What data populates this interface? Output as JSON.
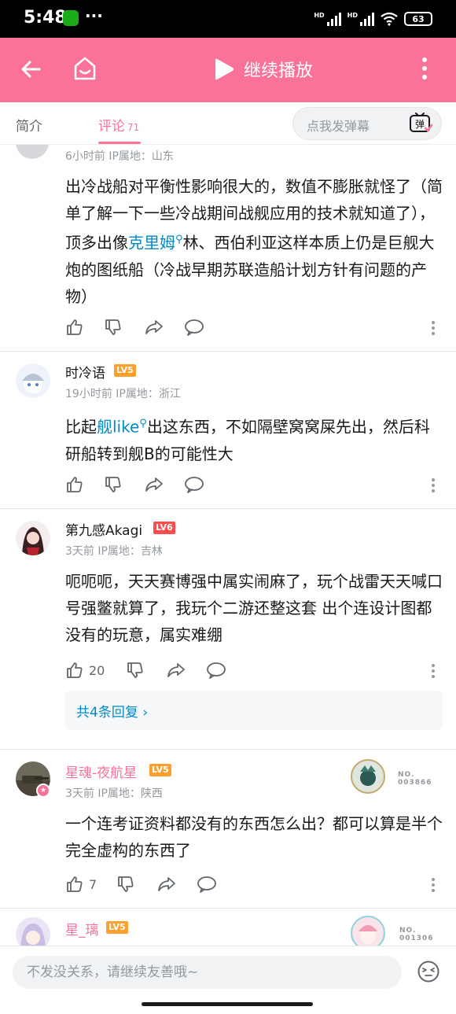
{
  "status": {
    "time": "5:48",
    "dots": "···",
    "hd1": "HD",
    "hd2": "HD",
    "battery": "63"
  },
  "header": {
    "title": "继续播放"
  },
  "tabs": {
    "intro": "简介",
    "comments": "评论",
    "comments_count": "71",
    "danmaku_placeholder": "点我发弹幕",
    "danmaku_icon_char": "弹"
  },
  "comments": [
    {
      "meta": "6小时前 IP属地：山东",
      "text_a": "出冷战船对平衡性影响很大的，数值不膨胀就怪了（简单了解一下一些冷战期间战舰应用的技术就知道了），顶多出像",
      "keyword": "克里姆",
      "text_b": "林、西伯利亚这样本质上仍是巨舰大炮的图纸船（冷战早期苏联造船计划方针有问题的产物）"
    },
    {
      "name": "时冷语",
      "level": "LV5",
      "meta": "19小时前 IP属地：浙江",
      "text_a": "比起",
      "keyword": "舰like",
      "text_b": "出这东西，不如隔壁窝窝屎先出，然后科研船转到舰B的可能性大"
    },
    {
      "name": "第九感Akagi",
      "level": "LV6",
      "meta": "3天前 IP属地：吉林",
      "text": "呃呃呃，天天赛博强中属实闹麻了，玩个战雷天天喊口号强鳖就算了，我玩个二游还整这套 出个连设计图都没有的玩意，属实难绷",
      "likes": "20",
      "replies": "共4条回复"
    },
    {
      "name": "星魂-夜航星",
      "level": "LV5",
      "meta": "3天前 IP属地：陕西",
      "text": "一个连考证资料都没有的东西怎么出？都可以算是半个完全虚构的东西了",
      "likes": "7",
      "badge_no_1": "NO.",
      "badge_no_2": "003866"
    },
    {
      "name": "星_璃",
      "level": "LV5",
      "badge_no_1": "NO.",
      "badge_no_2": "001306"
    }
  ],
  "bottom": {
    "input_placeholder": "不发没关系，请继续友善哦~"
  },
  "colors": {
    "accent": "#fb7299",
    "link": "#008ac5",
    "lv5": "#ff9f2e",
    "lv6": "#ff4d4f"
  }
}
